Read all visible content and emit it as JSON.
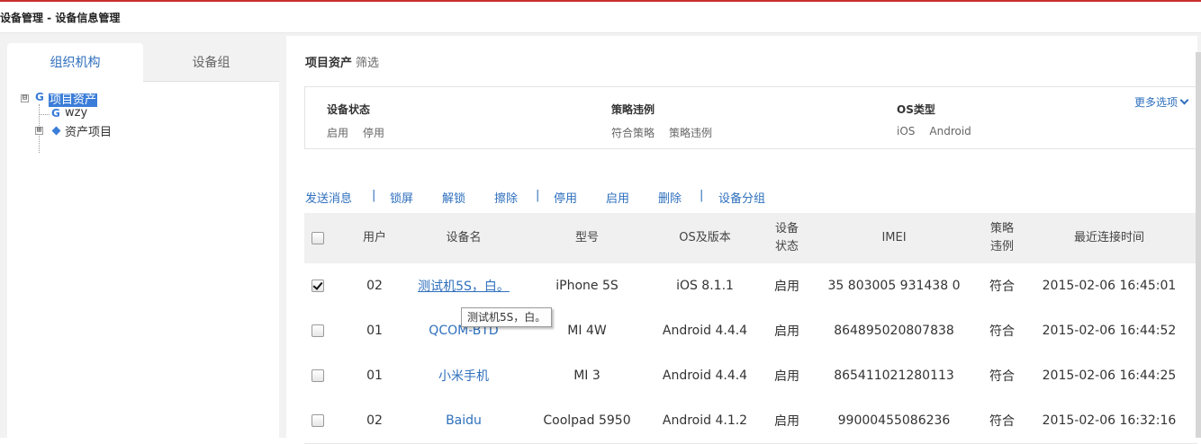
{
  "header": {
    "title": "设备管理 -  设备信息管理"
  },
  "left_tabs": [
    {
      "label": "组织机构"
    },
    {
      "label": "设备组"
    }
  ],
  "tree": {
    "root": {
      "label": "项目资产",
      "icon": "G"
    },
    "children": [
      {
        "label": "wzy",
        "icon": "G"
      },
      {
        "label": "资产项目",
        "icon": "diamond"
      }
    ],
    "toggle_expanded": "⊟",
    "toggle_collapsed": "⊞"
  },
  "breadcrumb": {
    "section": "项目资产",
    "filter": "筛选"
  },
  "filters": [
    {
      "heading": "设备状态",
      "options": [
        "启用",
        "停用"
      ]
    },
    {
      "heading": "策略违例",
      "options": [
        "符合策略",
        "策略违例"
      ]
    },
    {
      "heading": "OS类型",
      "options": [
        "iOS",
        "Android"
      ]
    }
  ],
  "more_options": "更多选项",
  "actions": [
    "发送消息",
    "锁屏",
    "解锁",
    "擦除",
    "停用",
    "启用",
    "删除",
    "设备分组"
  ],
  "separator": "|",
  "table": {
    "headers": [
      "用户",
      "设备名",
      "型号",
      "OS及版本",
      "设备状态",
      "IMEI",
      "策略违例",
      "最近连接时间"
    ],
    "header_lines": {
      "status": [
        "设备",
        "状态"
      ],
      "violation": [
        "策略",
        "违例"
      ]
    },
    "rows": [
      {
        "checked": true,
        "user": "02",
        "name": "测试机5S，白。",
        "model": "iPhone 5S",
        "os": "iOS 8.1.1",
        "status": "启用",
        "imei": "35 803005 931438 0",
        "violation": "符合",
        "time": "2015-02-06 16:45:01"
      },
      {
        "checked": false,
        "user": "01",
        "name": "QCOM-BTD",
        "model": "MI 4W",
        "os": "Android 4.4.4",
        "status": "启用",
        "imei": "864895020807838",
        "violation": "符合",
        "time": "2015-02-06 16:44:52"
      },
      {
        "checked": false,
        "user": "01",
        "name": "小米手机",
        "model": "MI 3",
        "os": "Android 4.4.4",
        "status": "启用",
        "imei": "865411021280113",
        "violation": "符合",
        "time": "2015-02-06 16:44:25"
      },
      {
        "checked": false,
        "user": "02",
        "name": "Baidu",
        "model": "Coolpad 5950",
        "os": "Android 4.1.2",
        "status": "启用",
        "imei": "99000455086236",
        "violation": "符合",
        "time": "2015-02-06 16:32:16"
      }
    ]
  },
  "tooltip": "测试机5S，白。",
  "colors": {
    "accent": "#2e6fbd",
    "tree_selected": "#3b7dd8",
    "top_line": "#c9302c"
  }
}
